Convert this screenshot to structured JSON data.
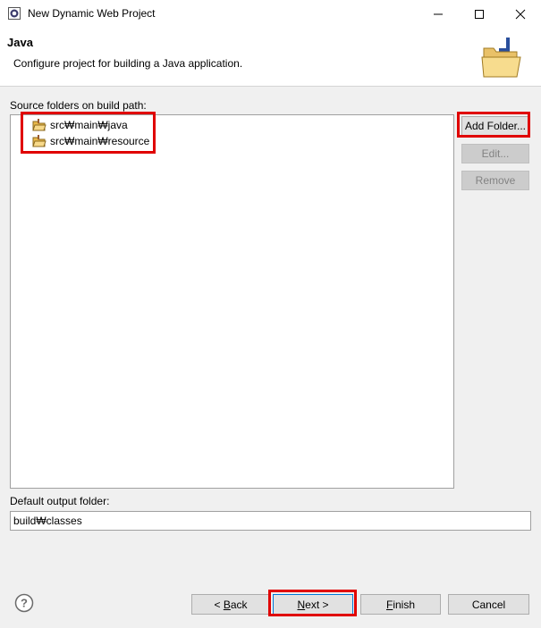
{
  "window": {
    "title": "New Dynamic Web Project",
    "minimize_icon": "minimize-icon",
    "maximize_icon": "maximize-icon",
    "close_icon": "close-icon"
  },
  "banner": {
    "title": "Java",
    "description": "Configure project for building a Java application.",
    "image_icon": "open-folder-icon"
  },
  "source_folders": {
    "label": "Source folders on build path:",
    "items": [
      {
        "label": "src₩main₩java",
        "icon": "source-folder-icon"
      },
      {
        "label": "src₩main₩resource",
        "icon": "source-folder-icon"
      }
    ]
  },
  "side_buttons": {
    "add": "Add Folder...",
    "edit": "Edit...",
    "remove": "Remove"
  },
  "output": {
    "label": "Default output folder:",
    "value": "build₩classes"
  },
  "footer": {
    "help_icon": "help-icon",
    "back_prefix": "< ",
    "back_mnemonic": "B",
    "back_rest": "ack",
    "next_mnemonic": "N",
    "next_rest": "ext >",
    "finish_mnemonic": "F",
    "finish_rest": "inish",
    "cancel": "Cancel"
  },
  "colors": {
    "highlight": "#e00000",
    "dialog_bg": "#f0f0f0",
    "default_button_border": "#0078d7"
  }
}
